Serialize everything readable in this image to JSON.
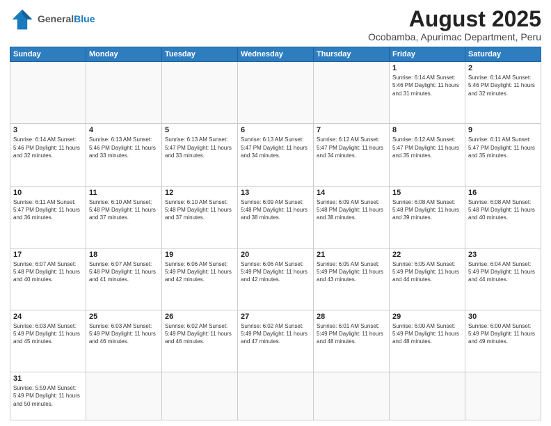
{
  "header": {
    "logo_general": "General",
    "logo_blue": "Blue",
    "title": "August 2025",
    "subtitle": "Ocobamba, Apurimac Department, Peru"
  },
  "days_of_week": [
    "Sunday",
    "Monday",
    "Tuesday",
    "Wednesday",
    "Thursday",
    "Friday",
    "Saturday"
  ],
  "weeks": [
    [
      {
        "day": "",
        "info": ""
      },
      {
        "day": "",
        "info": ""
      },
      {
        "day": "",
        "info": ""
      },
      {
        "day": "",
        "info": ""
      },
      {
        "day": "",
        "info": ""
      },
      {
        "day": "1",
        "info": "Sunrise: 6:14 AM\nSunset: 5:46 PM\nDaylight: 11 hours\nand 31 minutes."
      },
      {
        "day": "2",
        "info": "Sunrise: 6:14 AM\nSunset: 5:46 PM\nDaylight: 11 hours\nand 32 minutes."
      }
    ],
    [
      {
        "day": "3",
        "info": "Sunrise: 6:14 AM\nSunset: 5:46 PM\nDaylight: 11 hours\nand 32 minutes."
      },
      {
        "day": "4",
        "info": "Sunrise: 6:13 AM\nSunset: 5:46 PM\nDaylight: 11 hours\nand 33 minutes."
      },
      {
        "day": "5",
        "info": "Sunrise: 6:13 AM\nSunset: 5:47 PM\nDaylight: 11 hours\nand 33 minutes."
      },
      {
        "day": "6",
        "info": "Sunrise: 6:13 AM\nSunset: 5:47 PM\nDaylight: 11 hours\nand 34 minutes."
      },
      {
        "day": "7",
        "info": "Sunrise: 6:12 AM\nSunset: 5:47 PM\nDaylight: 11 hours\nand 34 minutes."
      },
      {
        "day": "8",
        "info": "Sunrise: 6:12 AM\nSunset: 5:47 PM\nDaylight: 11 hours\nand 35 minutes."
      },
      {
        "day": "9",
        "info": "Sunrise: 6:11 AM\nSunset: 5:47 PM\nDaylight: 11 hours\nand 35 minutes."
      }
    ],
    [
      {
        "day": "10",
        "info": "Sunrise: 6:11 AM\nSunset: 5:47 PM\nDaylight: 11 hours\nand 36 minutes."
      },
      {
        "day": "11",
        "info": "Sunrise: 6:10 AM\nSunset: 5:48 PM\nDaylight: 11 hours\nand 37 minutes."
      },
      {
        "day": "12",
        "info": "Sunrise: 6:10 AM\nSunset: 5:48 PM\nDaylight: 11 hours\nand 37 minutes."
      },
      {
        "day": "13",
        "info": "Sunrise: 6:09 AM\nSunset: 5:48 PM\nDaylight: 11 hours\nand 38 minutes."
      },
      {
        "day": "14",
        "info": "Sunrise: 6:09 AM\nSunset: 5:48 PM\nDaylight: 11 hours\nand 38 minutes."
      },
      {
        "day": "15",
        "info": "Sunrise: 6:08 AM\nSunset: 5:48 PM\nDaylight: 11 hours\nand 39 minutes."
      },
      {
        "day": "16",
        "info": "Sunrise: 6:08 AM\nSunset: 5:48 PM\nDaylight: 11 hours\nand 40 minutes."
      }
    ],
    [
      {
        "day": "17",
        "info": "Sunrise: 6:07 AM\nSunset: 5:48 PM\nDaylight: 11 hours\nand 40 minutes."
      },
      {
        "day": "18",
        "info": "Sunrise: 6:07 AM\nSunset: 5:48 PM\nDaylight: 11 hours\nand 41 minutes."
      },
      {
        "day": "19",
        "info": "Sunrise: 6:06 AM\nSunset: 5:49 PM\nDaylight: 11 hours\nand 42 minutes."
      },
      {
        "day": "20",
        "info": "Sunrise: 6:06 AM\nSunset: 5:49 PM\nDaylight: 11 hours\nand 42 minutes."
      },
      {
        "day": "21",
        "info": "Sunrise: 6:05 AM\nSunset: 5:49 PM\nDaylight: 11 hours\nand 43 minutes."
      },
      {
        "day": "22",
        "info": "Sunrise: 6:05 AM\nSunset: 5:49 PM\nDaylight: 11 hours\nand 44 minutes."
      },
      {
        "day": "23",
        "info": "Sunrise: 6:04 AM\nSunset: 5:49 PM\nDaylight: 11 hours\nand 44 minutes."
      }
    ],
    [
      {
        "day": "24",
        "info": "Sunrise: 6:03 AM\nSunset: 5:49 PM\nDaylight: 11 hours\nand 45 minutes."
      },
      {
        "day": "25",
        "info": "Sunrise: 6:03 AM\nSunset: 5:49 PM\nDaylight: 11 hours\nand 46 minutes."
      },
      {
        "day": "26",
        "info": "Sunrise: 6:02 AM\nSunset: 5:49 PM\nDaylight: 11 hours\nand 46 minutes."
      },
      {
        "day": "27",
        "info": "Sunrise: 6:02 AM\nSunset: 5:49 PM\nDaylight: 11 hours\nand 47 minutes."
      },
      {
        "day": "28",
        "info": "Sunrise: 6:01 AM\nSunset: 5:49 PM\nDaylight: 11 hours\nand 48 minutes."
      },
      {
        "day": "29",
        "info": "Sunrise: 6:00 AM\nSunset: 5:49 PM\nDaylight: 11 hours\nand 48 minutes."
      },
      {
        "day": "30",
        "info": "Sunrise: 6:00 AM\nSunset: 5:49 PM\nDaylight: 11 hours\nand 49 minutes."
      }
    ],
    [
      {
        "day": "31",
        "info": "Sunrise: 5:59 AM\nSunset: 5:49 PM\nDaylight: 11 hours\nand 50 minutes."
      },
      {
        "day": "",
        "info": ""
      },
      {
        "day": "",
        "info": ""
      },
      {
        "day": "",
        "info": ""
      },
      {
        "day": "",
        "info": ""
      },
      {
        "day": "",
        "info": ""
      },
      {
        "day": "",
        "info": ""
      }
    ]
  ]
}
